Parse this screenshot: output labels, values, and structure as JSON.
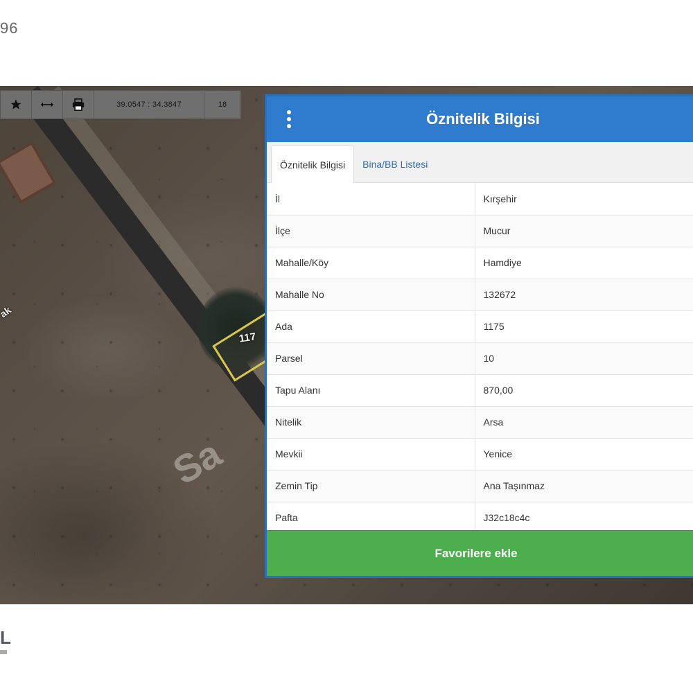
{
  "page": {
    "corner_number": "96",
    "corner_logo": "L"
  },
  "map": {
    "parcel_label": "117",
    "street_label": "ak",
    "watermark": "Sa"
  },
  "toolbar": {
    "favorite_icon": "star-icon",
    "measure_icon": "ruler-icon",
    "print_icon": "printer-icon",
    "coordinates": "39.0547 : 34.3847",
    "zoom_level": "18"
  },
  "panel": {
    "title": "Öznitelik Bilgisi",
    "menu_icon": "vertical-dots-icon",
    "tabs": [
      {
        "label": "Öznitelik Bilgisi",
        "active": true
      },
      {
        "label": "Bina/BB Listesi",
        "active": false
      }
    ],
    "rows": [
      {
        "key": "İl",
        "value": "Kırşehir"
      },
      {
        "key": "İlçe",
        "value": "Mucur"
      },
      {
        "key": "Mahalle/Köy",
        "value": "Hamdiye"
      },
      {
        "key": "Mahalle No",
        "value": "132672"
      },
      {
        "key": "Ada",
        "value": "1175"
      },
      {
        "key": "Parsel",
        "value": "10"
      },
      {
        "key": "Tapu Alanı",
        "value": "870,00"
      },
      {
        "key": "Nitelik",
        "value": "Arsa"
      },
      {
        "key": "Mevkii",
        "value": "Yenice"
      },
      {
        "key": "Zemin Tip",
        "value": "Ana Taşınmaz"
      },
      {
        "key": "Pafta",
        "value": "J32c18c4c"
      }
    ],
    "favorite_button": "Favorilere ekle"
  },
  "colors": {
    "header_blue": "#2f7bcd",
    "button_green": "#4cae4c",
    "toolbar_gray": "#6f6f6f"
  }
}
